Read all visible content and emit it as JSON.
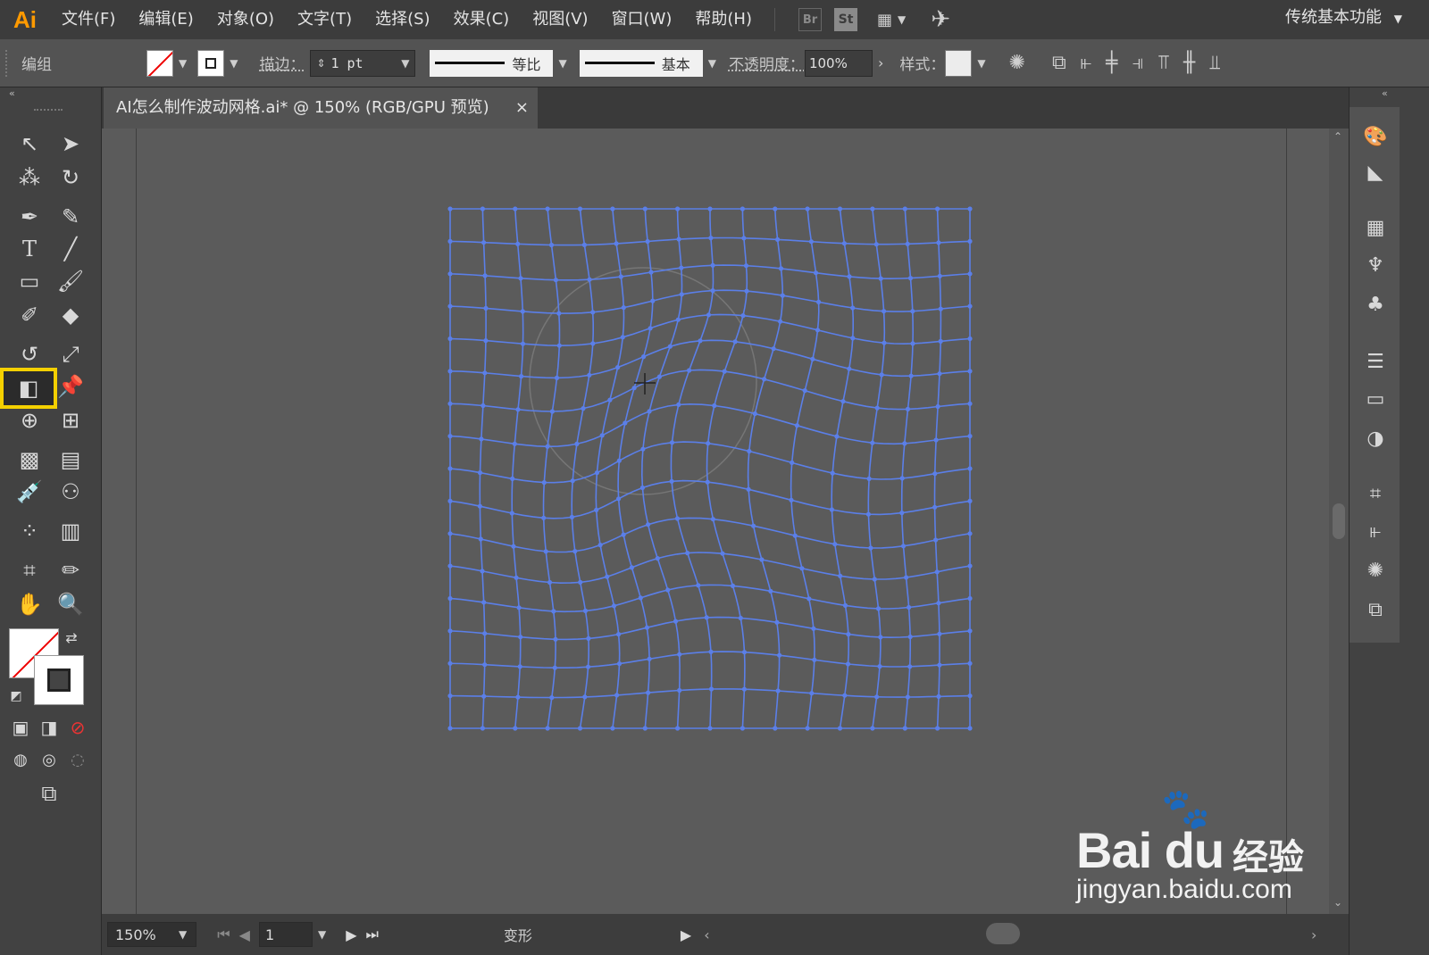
{
  "app": {
    "logo": "Ai"
  },
  "menu": {
    "items": [
      "文件(F)",
      "编辑(E)",
      "对象(O)",
      "文字(T)",
      "选择(S)",
      "效果(C)",
      "视图(V)",
      "窗口(W)",
      "帮助(H)"
    ],
    "bridge": "Br",
    "stock": "St",
    "workspace": "传统基本功能"
  },
  "control": {
    "selection_label": "编组",
    "stroke_label": "描边：",
    "stroke_weight": "1 pt",
    "profile_label": "等比",
    "brush_label": "基本",
    "opacity_label": "不透明度：",
    "opacity_value": "100%",
    "style_label": "样式："
  },
  "document": {
    "tab_title": "AI怎么制作波动网格.ai* @ 150% (RGB/GPU 预览)",
    "close": "×"
  },
  "status": {
    "zoom": "150%",
    "page": "1",
    "tool_name": "变形"
  },
  "watermark": {
    "brand": "Bai du",
    "cn": "经验",
    "url": "jingyan.baidu.com"
  },
  "colors": {
    "accent": "#ff9a00",
    "selection_highlight": "#f4d000",
    "grid_line": "#5b7fe8",
    "canvas": "#5b5b5b"
  }
}
